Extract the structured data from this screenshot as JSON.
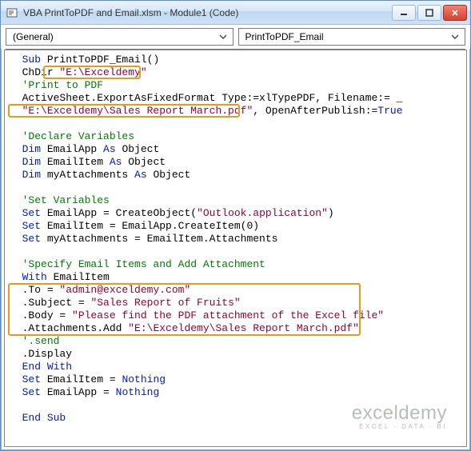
{
  "window": {
    "title": "VBA PrintToPDF and Email.xlsm - Module1 (Code)"
  },
  "dropdowns": {
    "left": "(General)",
    "right": "PrintToPDF_Email"
  },
  "code": {
    "l1a": "Sub",
    "l1b": " PrintToPDF_Email()",
    "l2a": "ChDir ",
    "l2b": "\"E:\\Exceldemy\"",
    "l3": "'Print to PDF",
    "l4a": "ActiveSheet.ExportAsFixedFormat Type:=xlTypePDF, Filename:= _",
    "l5a": "\"E:\\Exceldemy\\Sales Report March.pdf\"",
    "l5b": ", OpenAfterPublish:=",
    "l5c": "True",
    "l6": "",
    "l7": "'Declare Variables",
    "l8a": "Dim",
    "l8b": " EmailApp ",
    "l8c": "As",
    "l8d": " Object",
    "l9a": "Dim",
    "l9b": " EmailItem ",
    "l9c": "As",
    "l9d": " Object",
    "l10a": "Dim",
    "l10b": " myAttachments ",
    "l10c": "As",
    "l10d": " Object",
    "l11": "",
    "l12": "'Set Variables",
    "l13a": "Set",
    "l13b": " EmailApp = CreateObject(",
    "l13c": "\"Outlook.application\"",
    "l13d": ")",
    "l14a": "Set",
    "l14b": " EmailItem = EmailApp.CreateItem(0)",
    "l15a": "Set",
    "l15b": " myAttachments = EmailItem.Attachments",
    "l16": "",
    "l17": "'Specify Email Items and Add Attachment",
    "l18a": "With",
    "l18b": " EmailItem",
    "l19a": ".To = ",
    "l19b": "\"admin@exceldemy.com\"",
    "l20a": ".Subject = ",
    "l20b": "\"Sales Report of Fruits\"",
    "l21a": ".Body = ",
    "l21b": "\"Please find the PDF attachment of the Excel file\"",
    "l22a": ".Attachments.Add ",
    "l22b": "\"E:\\Exceldemy\\Sales Report March.pdf\"",
    "l23": "'.send",
    "l24": ".Display",
    "l25": "End With",
    "l26a": "Set",
    "l26b": " EmailItem = ",
    "l26c": "Nothing",
    "l27a": "Set",
    "l27b": " EmailApp = ",
    "l27c": "Nothing",
    "l28": "",
    "l29": "End Sub"
  },
  "watermark": {
    "main": "exceldemy",
    "sub": "EXCEL · DATA · BI"
  }
}
